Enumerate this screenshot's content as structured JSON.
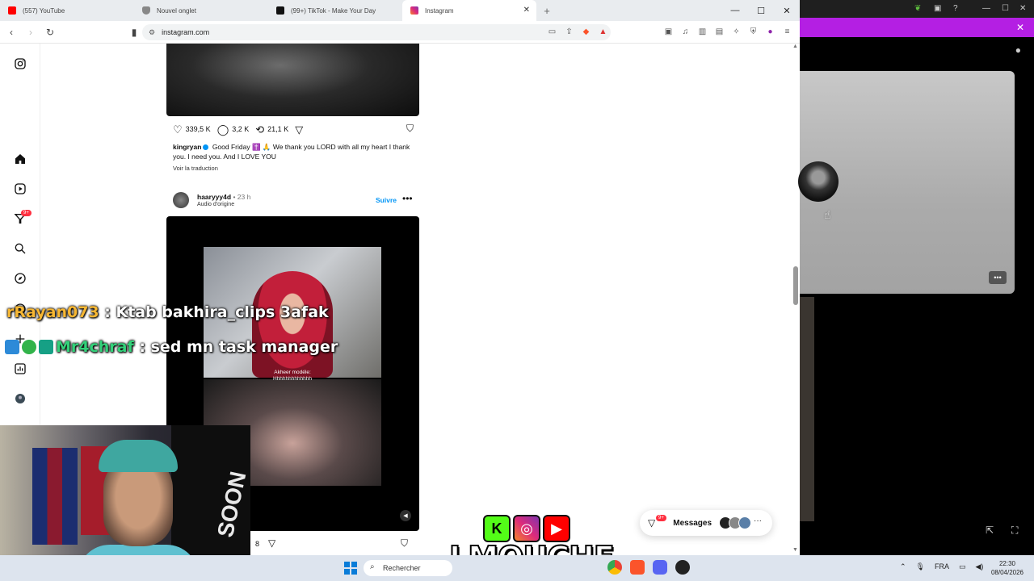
{
  "browser": {
    "tabs": [
      {
        "label": "(557) YouTube",
        "icon": "youtube-icon",
        "color": "#ff0000"
      },
      {
        "label": "Nouvel onglet",
        "icon": "shield-icon",
        "color": "#666666"
      },
      {
        "label": "(99+) TikTok - Make Your Day",
        "icon": "tiktok-icon",
        "color": "#111111"
      },
      {
        "label": "Instagram",
        "icon": "instagram-icon",
        "color": "#d62976",
        "active": true
      }
    ],
    "url": "instagram.com"
  },
  "sidebar": {
    "notification_count": "9+",
    "items": [
      "instagram-logo",
      "home",
      "reels",
      "notifications",
      "search",
      "explore",
      "messages",
      "create",
      "dashboard",
      "profile"
    ]
  },
  "post1": {
    "likes": "339,5 K",
    "comments": "3,2 K",
    "reposts": "21,1 K",
    "username": "kingryan",
    "caption": "Good Friday ✝️ 🙏 We thank you LORD with all my heart I thank you. I need you. And I LOVE YOU",
    "translate": "Voir la traduction"
  },
  "post2": {
    "username": "haaryyy4d",
    "time": "23 h",
    "audio": "Audio d'origine",
    "follow": "Suivre",
    "video_caption_line1": "Akheer modéle:",
    "video_caption_line2": "Hhhhhhhhhhhhh",
    "bottom_count": "8"
  },
  "messages": {
    "badge": "9+",
    "label": "Messages"
  },
  "stream": {
    "chat": [
      {
        "user": "rRayan073",
        "message": " : Ktab bakhira_clips 3afak"
      },
      {
        "user": "Mr4chraf",
        "message": " : sed mn task manager"
      }
    ],
    "brand": "LMOUCHE",
    "webcam_text": "SOON"
  },
  "taskbar": {
    "search_placeholder": "Rechercher",
    "lang": "FRA",
    "time": "22:30",
    "date": "08/04/2026"
  },
  "colors": {
    "accent_purple": "#b41fe3",
    "ig_blue": "#0095f6",
    "badge_red": "#ff3040"
  }
}
